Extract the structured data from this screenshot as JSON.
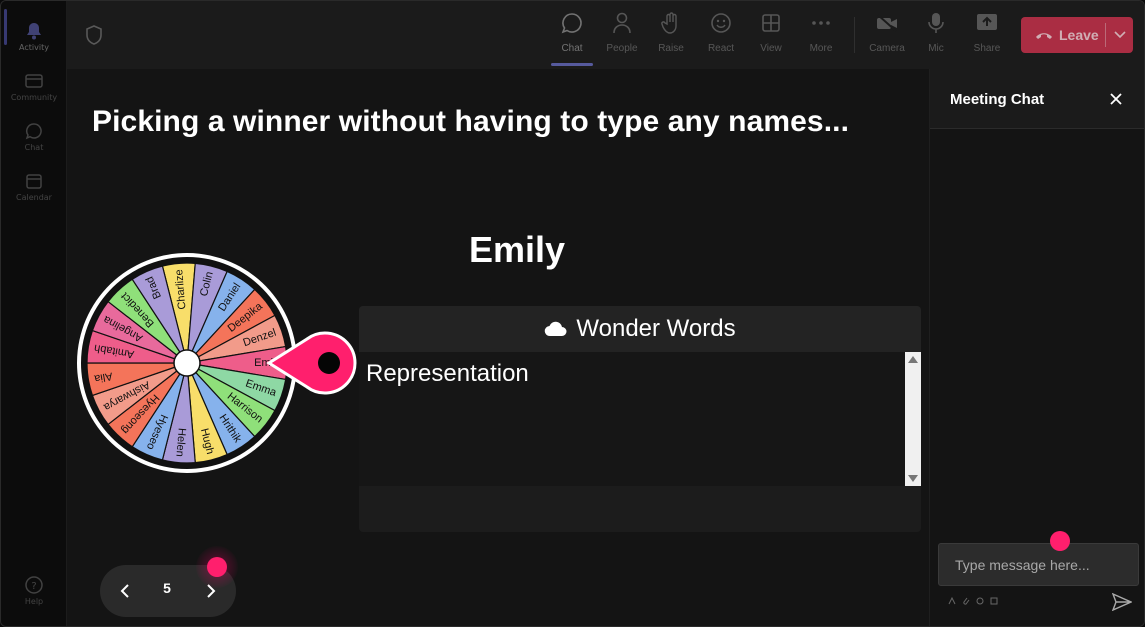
{
  "rail": {
    "items": [
      {
        "label": "Activity",
        "icon": "bell-icon"
      },
      {
        "label": "Community",
        "icon": "community-icon"
      },
      {
        "label": "Chat",
        "icon": "chat-icon"
      },
      {
        "label": "Calendar",
        "icon": "calendar-icon"
      },
      {
        "label": "Help",
        "icon": "help-icon"
      }
    ]
  },
  "toolbar": {
    "items": [
      {
        "label": "Chat",
        "icon": "chat-icon"
      },
      {
        "label": "People",
        "icon": "people-icon"
      },
      {
        "label": "Raise",
        "icon": "hand-icon"
      },
      {
        "label": "React",
        "icon": "smiley-icon"
      },
      {
        "label": "View",
        "icon": "grid-icon"
      },
      {
        "label": "More",
        "icon": "more-icon"
      },
      {
        "label": "Camera",
        "icon": "camera-off-icon"
      },
      {
        "label": "Mic",
        "icon": "mic-icon"
      },
      {
        "label": "Share",
        "icon": "share-icon"
      }
    ],
    "leave_label": "Leave"
  },
  "stage": {
    "headline": "Picking a winner without having to type any names...",
    "winner": "Emily",
    "wheel": {
      "names": [
        "Charlize",
        "Colin",
        "Daniel",
        "Deepika",
        "Denzel",
        "Emily",
        "Emma",
        "Harrison",
        "Hrithik",
        "Hugh",
        "Helen",
        "Hyeseo",
        "Hyeseong",
        "Aishwarya",
        "Alia",
        "Amitabh",
        "Angelina",
        "Benedict",
        "Brad"
      ],
      "colors": [
        "#f8de6a",
        "#a99bd8",
        "#86b2ec",
        "#f4745a",
        "#f29b8a",
        "#ee5d8a",
        "#8ed8a4",
        "#8fe07a",
        "#86b2ec",
        "#f8de6a",
        "#a99bd8",
        "#86b2ec",
        "#f4745a",
        "#f29b8a",
        "#f4745a",
        "#ee5d8a",
        "#e86a9c",
        "#8fe07a",
        "#a99bd8"
      ],
      "pointer_color": "#ff1f6d"
    },
    "wonder_words": {
      "title": "Wonder Words",
      "text": "Representation"
    },
    "pager": {
      "page": "5"
    }
  },
  "chat": {
    "title": "Meeting Chat",
    "placeholder": "Type message here...",
    "accent": "#ff1f6d"
  }
}
